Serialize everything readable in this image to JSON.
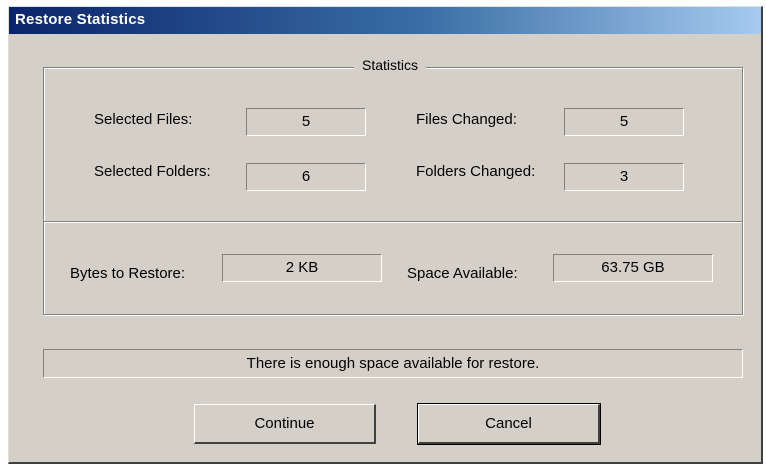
{
  "window": {
    "title": "Restore Statistics"
  },
  "statistics": {
    "legend": "Statistics",
    "selected_files_label": "Selected Files:",
    "selected_files_value": "5",
    "files_changed_label": "Files Changed:",
    "files_changed_value": "5",
    "selected_folders_label": "Selected Folders:",
    "selected_folders_value": "6",
    "folders_changed_label": "Folders Changed:",
    "folders_changed_value": "3",
    "bytes_to_restore_label": "Bytes to Restore:",
    "bytes_to_restore_value": "2 KB",
    "space_available_label": "Space Available:",
    "space_available_value": "63.75 GB"
  },
  "status": {
    "message": "There is enough space available for restore."
  },
  "buttons": {
    "continue_label": "Continue",
    "cancel_label": "Cancel"
  }
}
